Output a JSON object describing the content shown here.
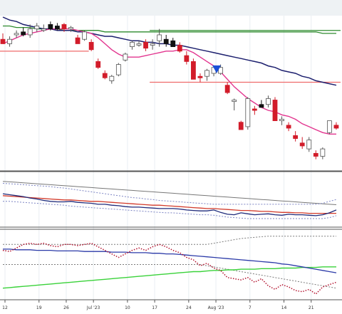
{
  "colors": {
    "background": "#ffffff",
    "header_bar": "#eef2f4",
    "grid": "#e9eef2",
    "panel_divider": "#555555",
    "up_candle_fill": "#ffffff",
    "up_candle_stroke": "#555555",
    "down_candle": "#d21c2a",
    "black_candle": "#111111",
    "ma_short": "#e2358f",
    "ma_long": "#1c1f6e",
    "ma_green": "#2e8b2e",
    "hline": "#ef6b6b",
    "signal_marker": "#1a4fd6",
    "ind1_primary": "#1f2a7a",
    "ind1_secondary": "#d23a2a",
    "ind1_band": "#7c84c4",
    "ind2_primary": "#2b3aa8",
    "ind2_dotted": "#b3122e",
    "ind2_green": "#3ad23a",
    "ind2_band": "#7b7b7b",
    "axis_text": "#333333"
  },
  "chart_data": {
    "type": "candlestick",
    "x_tick_labels": [
      "12",
      "19",
      "26",
      "Jul '23",
      "10",
      "17",
      "24",
      "Aug '23",
      "7",
      "14",
      "21"
    ],
    "y_range": [
      0,
      100
    ],
    "grid": true,
    "price_panel": {
      "candles": [
        {
          "o": 85,
          "h": 89,
          "l": 82,
          "c": 82,
          "color": "down"
        },
        {
          "o": 82,
          "h": 87,
          "l": 80,
          "c": 85,
          "color": "up"
        },
        {
          "o": 88,
          "h": 91,
          "l": 86,
          "c": 89,
          "color": "up"
        },
        {
          "o": 90,
          "h": 93,
          "l": 87,
          "c": 88,
          "color": "black"
        },
        {
          "o": 88,
          "h": 95,
          "l": 86,
          "c": 92,
          "color": "up"
        },
        {
          "o": 92,
          "h": 96,
          "l": 90,
          "c": 94,
          "color": "up"
        },
        {
          "o": 92,
          "h": 95,
          "l": 90,
          "c": 91,
          "color": "up"
        },
        {
          "o": 95,
          "h": 97,
          "l": 91,
          "c": 92,
          "color": "black"
        },
        {
          "o": 94,
          "h": 96,
          "l": 91,
          "c": 92,
          "color": "black"
        },
        {
          "o": 95,
          "h": 96,
          "l": 90,
          "c": 92,
          "color": "down"
        },
        {
          "o": 92,
          "h": 94,
          "l": 90,
          "c": 93,
          "color": "up"
        },
        {
          "o": 86,
          "h": 88,
          "l": 82,
          "c": 82,
          "color": "down"
        },
        {
          "o": 85,
          "h": 91,
          "l": 84,
          "c": 90,
          "color": "up"
        },
        {
          "o": 83,
          "h": 85,
          "l": 77,
          "c": 78,
          "color": "down"
        },
        {
          "o": 70,
          "h": 72,
          "l": 65,
          "c": 66,
          "color": "down"
        },
        {
          "o": 62,
          "h": 64,
          "l": 58,
          "c": 59,
          "color": "down"
        },
        {
          "o": 57,
          "h": 61,
          "l": 55,
          "c": 60,
          "color": "up"
        },
        {
          "o": 61,
          "h": 69,
          "l": 60,
          "c": 68,
          "color": "up"
        },
        {
          "o": 71,
          "h": 76,
          "l": 70,
          "c": 75,
          "color": "up"
        },
        {
          "o": 80,
          "h": 84,
          "l": 78,
          "c": 83,
          "color": "up"
        },
        {
          "o": 82,
          "h": 84,
          "l": 80,
          "c": 82,
          "color": "up"
        },
        {
          "o": 83,
          "h": 85,
          "l": 77,
          "c": 79,
          "color": "down"
        },
        {
          "o": 81,
          "h": 85,
          "l": 78,
          "c": 82,
          "color": "up"
        },
        {
          "o": 88,
          "h": 92,
          "l": 80,
          "c": 84,
          "color": "up"
        },
        {
          "o": 85,
          "h": 88,
          "l": 80,
          "c": 82,
          "color": "black"
        },
        {
          "o": 84,
          "h": 86,
          "l": 80,
          "c": 80,
          "color": "black"
        },
        {
          "o": 81,
          "h": 83,
          "l": 76,
          "c": 77,
          "color": "down"
        },
        {
          "o": 74,
          "h": 77,
          "l": 68,
          "c": 70,
          "color": "down"
        },
        {
          "o": 70,
          "h": 72,
          "l": 58,
          "c": 58,
          "color": "down"
        },
        {
          "o": 60,
          "h": 62,
          "l": 56,
          "c": 59,
          "color": "down"
        },
        {
          "o": 60,
          "h": 65,
          "l": 57,
          "c": 64,
          "color": "up"
        },
        {
          "o": 62,
          "h": 67,
          "l": 60,
          "c": 66,
          "color": "up"
        },
        {
          "o": 66,
          "h": 68,
          "l": 61,
          "c": 62,
          "color": "up"
        },
        {
          "o": 54,
          "h": 56,
          "l": 48,
          "c": 49,
          "color": "down"
        },
        {
          "o": 43,
          "h": 45,
          "l": 37,
          "c": 44,
          "color": "up"
        },
        {
          "o": 29,
          "h": 30,
          "l": 24,
          "c": 24,
          "color": "down"
        },
        {
          "o": 26,
          "h": 46,
          "l": 24,
          "c": 45,
          "color": "up"
        },
        {
          "o": 38,
          "h": 40,
          "l": 34,
          "c": 37,
          "color": "down"
        },
        {
          "o": 41,
          "h": 44,
          "l": 39,
          "c": 39,
          "color": "black"
        },
        {
          "o": 41,
          "h": 47,
          "l": 39,
          "c": 45,
          "color": "up"
        },
        {
          "o": 44,
          "h": 46,
          "l": 30,
          "c": 30,
          "color": "down"
        },
        {
          "o": 30,
          "h": 33,
          "l": 27,
          "c": 31,
          "color": "up"
        },
        {
          "o": 27,
          "h": 29,
          "l": 23,
          "c": 25,
          "color": "down"
        },
        {
          "o": 20,
          "h": 23,
          "l": 16,
          "c": 18,
          "color": "down"
        },
        {
          "o": 15,
          "h": 19,
          "l": 11,
          "c": 13,
          "color": "down"
        },
        {
          "o": 11,
          "h": 19,
          "l": 9,
          "c": 17,
          "color": "up"
        },
        {
          "o": 8,
          "h": 10,
          "l": 4,
          "c": 6,
          "color": "down"
        },
        {
          "o": 6,
          "h": 12,
          "l": 4,
          "c": 11,
          "color": "up"
        },
        {
          "o": 22,
          "h": 30,
          "l": 21,
          "c": 30,
          "color": "up"
        },
        {
          "o": 27,
          "h": 29,
          "l": 24,
          "c": 25,
          "color": "down"
        }
      ],
      "ma_short": [
        82,
        84,
        86,
        88,
        89,
        90,
        91,
        92,
        92,
        92,
        92,
        91,
        90,
        89,
        86,
        82,
        78,
        75,
        73,
        73,
        73,
        74,
        75,
        76,
        77,
        77,
        78,
        78,
        76,
        73,
        70,
        67,
        63,
        58,
        53,
        49,
        45,
        42,
        39,
        37,
        36,
        34,
        33,
        31,
        28,
        26,
        24,
        22,
        21,
        21
      ],
      "ma_long": [
        100,
        98,
        97,
        95,
        94,
        93,
        92,
        92,
        91,
        91,
        91,
        90,
        90,
        89,
        88,
        87,
        87,
        86,
        85,
        84,
        84,
        83,
        83,
        82,
        82,
        81,
        81,
        80,
        79,
        78,
        77,
        76,
        75,
        74,
        73,
        72,
        71,
        70,
        69,
        67,
        66,
        64,
        63,
        62,
        60,
        59,
        57,
        56,
        55,
        54
      ],
      "ma_green": [
        94,
        94,
        93,
        93,
        93,
        92,
        92,
        92,
        92,
        91,
        91,
        91,
        91,
        91,
        91,
        90,
        90,
        90,
        90,
        90,
        90,
        90,
        90,
        90,
        90,
        90,
        90,
        90,
        90,
        90,
        90,
        90,
        90,
        90,
        90,
        90,
        90,
        90,
        90,
        90,
        90,
        90,
        90,
        90,
        90,
        90,
        90,
        89,
        89,
        89
      ],
      "horizontal_levels": [
        {
          "value": 77,
          "from": 0,
          "to": 12
        },
        {
          "value": 91,
          "from": 22,
          "to": 49
        },
        {
          "value": 56,
          "from": 22,
          "to": 49
        }
      ],
      "signal_marker": {
        "index": 31,
        "value": 64,
        "shape": "down-triangle"
      }
    },
    "indicator1": {
      "primary": [
        64,
        62,
        60,
        58,
        55,
        53,
        50,
        48,
        47,
        47,
        48,
        46,
        45,
        44,
        42,
        42,
        40,
        39,
        37,
        36,
        36,
        35,
        34,
        33,
        33,
        33,
        32,
        30,
        29,
        28,
        28,
        30,
        25,
        21,
        20,
        24,
        22,
        20,
        21,
        22,
        20,
        19,
        21,
        20,
        20,
        19,
        18,
        20,
        24,
        30
      ],
      "secondary": [
        60,
        59,
        58,
        57,
        56,
        55,
        54,
        53,
        52,
        51,
        51,
        50,
        49,
        48,
        48,
        47,
        46,
        45,
        44,
        43,
        42,
        41,
        40,
        40,
        39,
        38,
        37,
        36,
        35,
        34,
        33,
        33,
        32,
        31,
        30,
        29,
        29,
        28,
        27,
        27,
        26,
        25,
        25,
        24,
        24,
        23,
        23,
        23,
        23,
        23
      ],
      "band_upper": [
        86,
        85,
        84,
        83,
        82,
        81,
        80,
        79,
        77,
        76,
        74,
        72,
        70,
        68,
        66,
        64,
        62,
        60,
        58,
        56,
        55,
        53,
        52,
        50,
        49,
        48,
        47,
        46,
        45,
        44,
        43,
        42,
        42,
        42,
        42,
        42,
        42,
        42,
        42,
        42,
        42,
        42,
        42,
        42,
        42,
        42,
        42,
        44,
        48,
        52
      ],
      "band_lower": [
        48,
        48,
        47,
        46,
        45,
        44,
        43,
        42,
        41,
        40,
        38,
        37,
        36,
        35,
        34,
        33,
        32,
        31,
        30,
        29,
        28,
        27,
        26,
        25,
        24,
        24,
        23,
        22,
        21,
        20,
        20,
        19,
        17,
        15,
        14,
        13,
        12,
        12,
        12,
        12,
        12,
        12,
        12,
        12,
        12,
        12,
        12,
        12,
        14,
        18
      ],
      "upper_line": [
        90,
        89,
        88,
        87,
        86,
        85,
        84,
        83,
        82,
        81,
        80,
        79,
        78,
        77,
        76,
        75,
        74,
        73,
        72,
        71,
        70,
        69,
        68,
        67,
        66,
        65,
        64,
        63,
        62,
        61,
        60,
        59,
        58,
        57,
        56,
        55,
        54,
        53,
        52,
        51,
        50,
        49,
        48,
        47,
        46,
        45,
        44,
        43,
        42,
        41
      ]
    },
    "indicator2": {
      "primary": [
        76,
        76,
        75,
        75,
        75,
        74,
        74,
        74,
        73,
        73,
        73,
        73,
        72,
        72,
        72,
        72,
        71,
        71,
        71,
        70,
        70,
        70,
        69,
        69,
        68,
        68,
        67,
        66,
        65,
        64,
        63,
        62,
        61,
        60,
        59,
        58,
        57,
        56,
        55,
        54,
        53,
        51,
        50,
        48,
        46,
        44,
        42,
        40,
        38,
        36
      ],
      "dotted": [
        74,
        72,
        78,
        84,
        86,
        84,
        86,
        82,
        80,
        84,
        84,
        82,
        84,
        86,
        80,
        74,
        68,
        62,
        68,
        74,
        78,
        74,
        80,
        84,
        80,
        74,
        70,
        62,
        58,
        48,
        52,
        44,
        40,
        28,
        26,
        24,
        28,
        20,
        26,
        14,
        8,
        16,
        12,
        6,
        4,
        8,
        0,
        12,
        16,
        20
      ],
      "green": [
        10,
        11,
        12,
        13,
        14,
        15,
        16,
        17,
        18,
        19,
        20,
        21,
        22,
        23,
        24,
        25,
        26,
        27,
        28,
        29,
        30,
        31,
        32,
        33,
        34,
        35,
        36,
        37,
        38,
        38,
        39,
        40,
        40,
        41,
        41,
        42,
        42,
        42,
        43,
        43,
        43,
        44,
        44,
        44,
        45,
        45,
        45,
        46,
        46,
        46
      ],
      "band_upper": [
        84,
        84,
        84,
        84,
        84,
        84,
        84,
        84,
        84,
        84,
        84,
        84,
        84,
        84,
        84,
        84,
        84,
        84,
        84,
        84,
        84,
        84,
        84,
        84,
        84,
        84,
        84,
        84,
        84,
        84,
        84,
        86,
        88,
        90,
        92,
        94,
        95,
        96,
        97,
        98,
        98,
        98,
        98,
        98,
        98,
        98,
        98,
        98,
        98,
        98
      ],
      "band_lower": [
        50,
        50,
        50,
        50,
        50,
        50,
        50,
        50,
        50,
        50,
        50,
        50,
        50,
        50,
        50,
        50,
        50,
        50,
        50,
        50,
        50,
        50,
        50,
        50,
        50,
        50,
        50,
        50,
        50,
        50,
        48,
        46,
        44,
        42,
        40,
        38,
        36,
        34,
        32,
        30,
        28,
        26,
        24,
        22,
        20,
        18,
        16,
        14,
        12,
        10
      ]
    }
  }
}
